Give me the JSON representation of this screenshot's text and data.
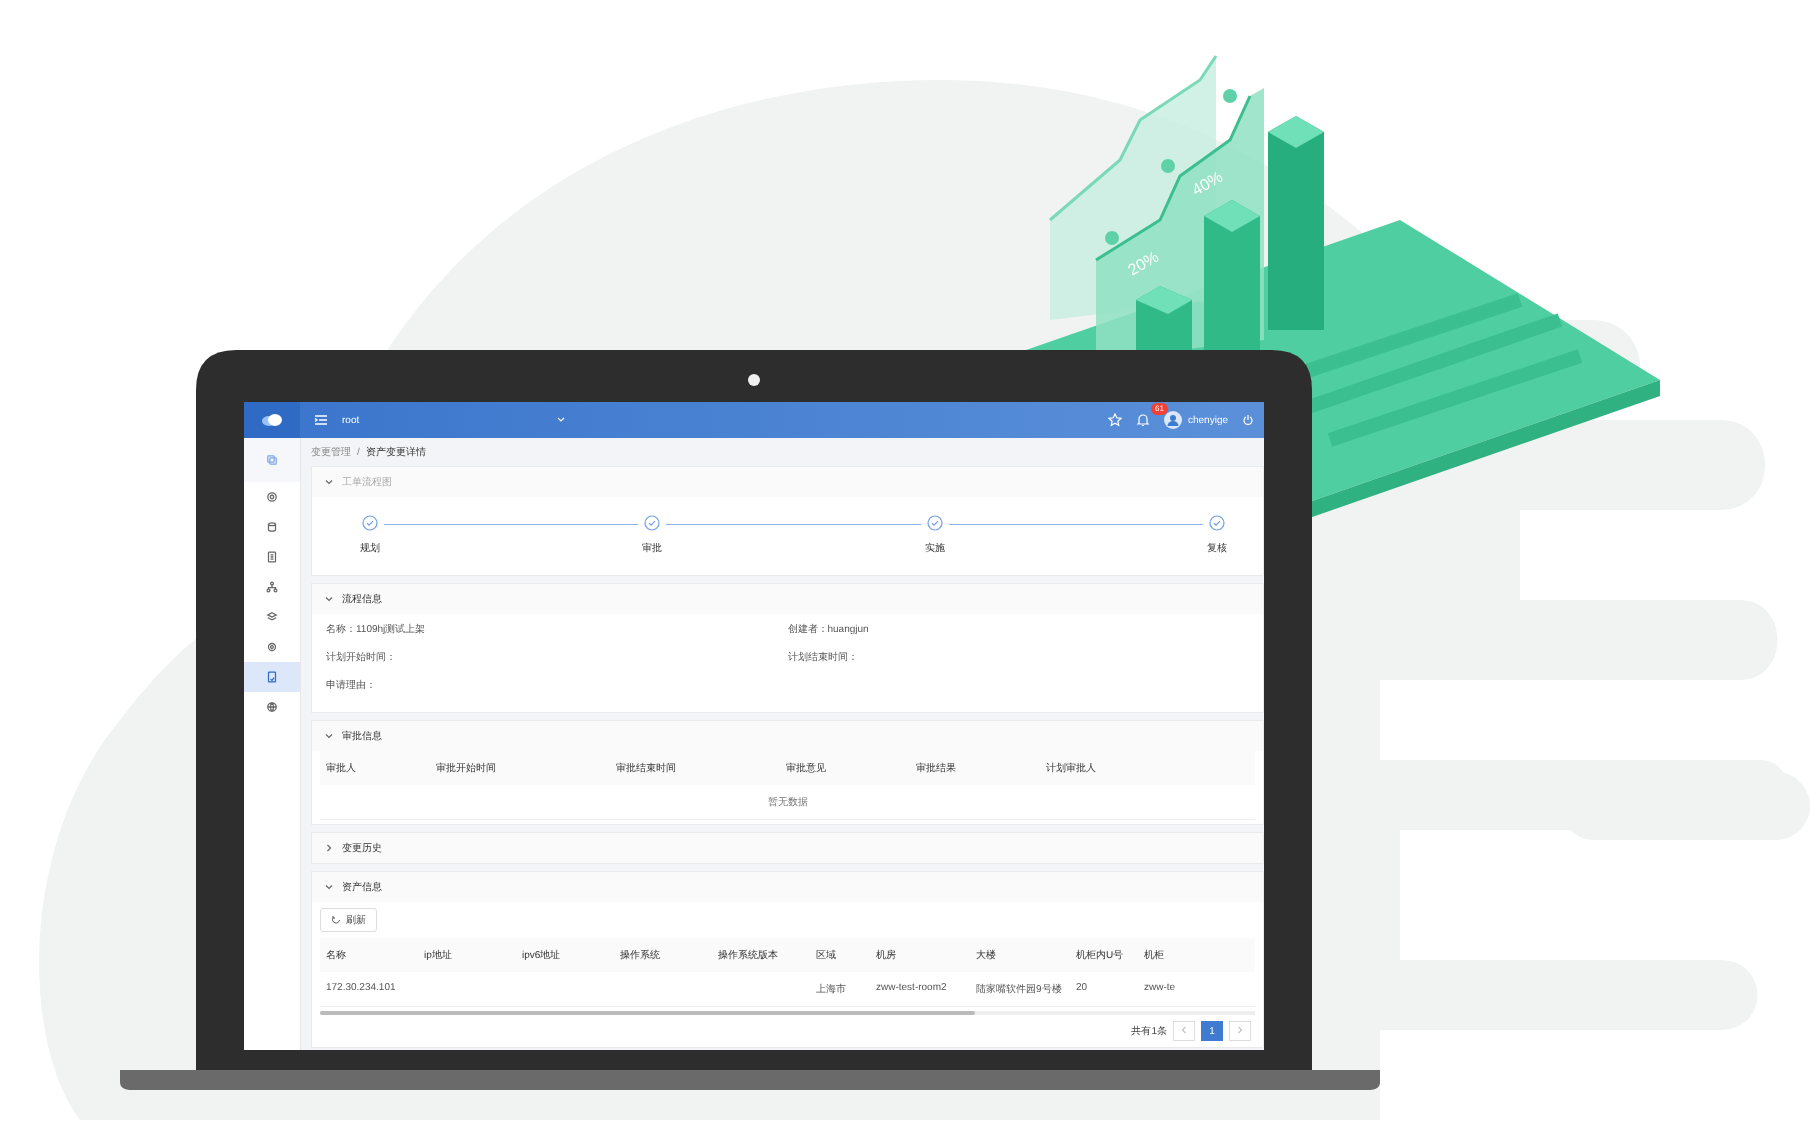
{
  "illustration": {
    "chart_labels": [
      "20%",
      "40%"
    ]
  },
  "topbar": {
    "project": "root",
    "notifications": "61",
    "user": "chenyige"
  },
  "sidebar": {
    "items": [
      {
        "kind": "header",
        "selected": false
      },
      {
        "kind": "item",
        "selected": false
      },
      {
        "kind": "item",
        "selected": false
      },
      {
        "kind": "item",
        "selected": false
      },
      {
        "kind": "item",
        "selected": false
      },
      {
        "kind": "item",
        "selected": false
      },
      {
        "kind": "item",
        "selected": false
      },
      {
        "kind": "item",
        "selected": true
      },
      {
        "kind": "item",
        "selected": false
      }
    ]
  },
  "breadcrumb": [
    "变更管理",
    "/",
    "资产变更详情"
  ],
  "flow_panel": {
    "title": "工单流程图",
    "expanded": true,
    "steps": [
      {
        "label": "规划",
        "done": true
      },
      {
        "label": "审批",
        "done": true
      },
      {
        "label": "实施",
        "done": true
      },
      {
        "label": "复核",
        "done": true
      }
    ]
  },
  "process_panel": {
    "title": "流程信息",
    "expanded": true,
    "fields": [
      "名称：1109hj测试上架",
      "创建者：huangjun",
      "计划开始时间：",
      "计划结束时间：",
      "申请理由："
    ]
  },
  "approval_panel": {
    "title": "审批信息",
    "expanded": true,
    "columns": [
      "审批人",
      "审批开始时间",
      "审批结束时间",
      "审批意见",
      "审批结果",
      "计划审批人"
    ],
    "empty_text": "暂无数据"
  },
  "history_panel": {
    "title": "变更历史",
    "expanded": false
  },
  "asset_panel": {
    "title": "资产信息",
    "expanded": true,
    "refresh_button": "刷新",
    "columns": [
      "名称",
      "ip地址",
      "ipv6地址",
      "操作系统",
      "操作系统版本",
      "区域",
      "机房",
      "大楼",
      "机柜内U号",
      "机柜"
    ],
    "rows": [
      [
        "172.30.234.101",
        null,
        null,
        null,
        null,
        "上海市",
        "zww-test-room2",
        "陆家嘴软件园9号楼",
        "20",
        "zww-te"
      ]
    ],
    "pagination": {
      "total": "共有1条",
      "pages": [
        {
          "label": "1",
          "selected": true
        }
      ]
    }
  }
}
